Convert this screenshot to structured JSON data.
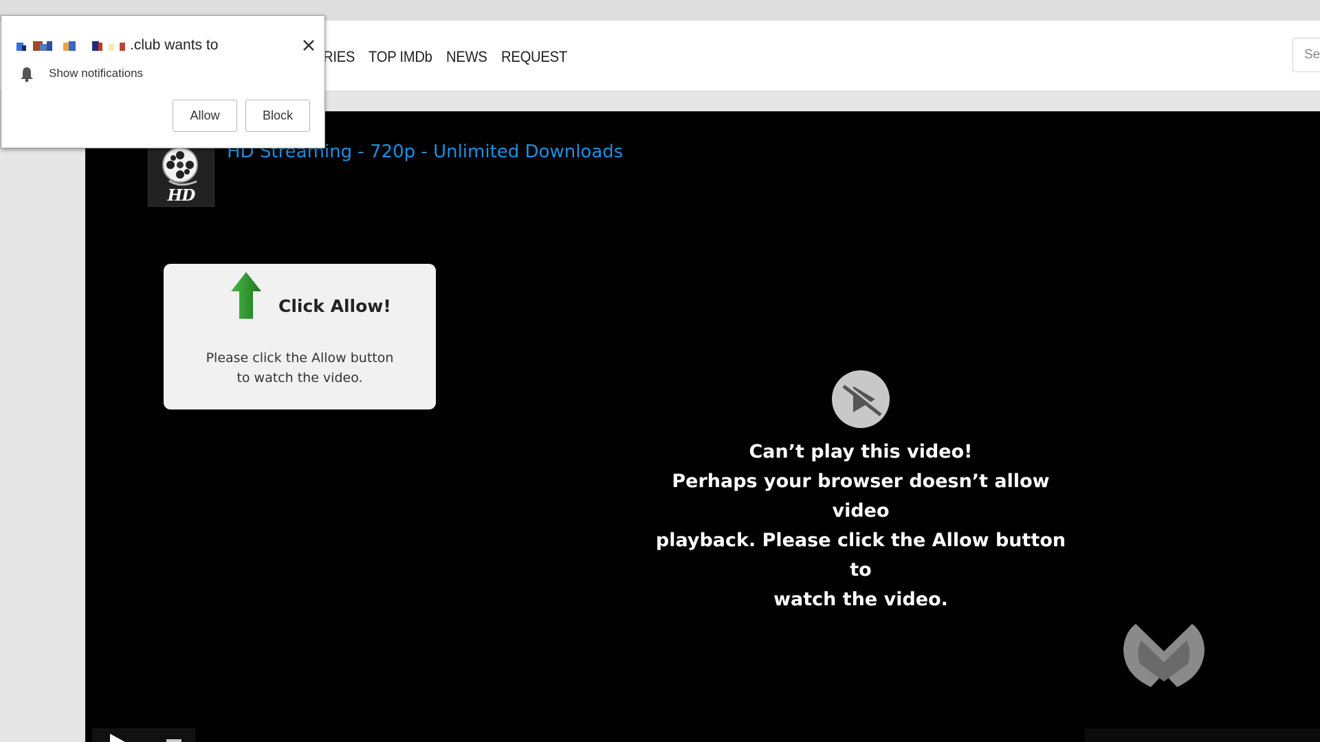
{
  "nav": {
    "items": [
      {
        "label": "RIES"
      },
      {
        "label": "TOP IMDb"
      },
      {
        "label": "NEWS"
      },
      {
        "label": "REQUEST"
      }
    ],
    "search_placeholder": "Se"
  },
  "site": {
    "logo_text": "HD",
    "heading": "HD Streaming - 720p - Unlimited Downloads",
    "heading_color": "#1e90e0"
  },
  "allow_card": {
    "title": "Click Allow!",
    "body_line1": "Please click the Allow button",
    "body_line2": "to watch the video.",
    "arrow_color": "#2a9a2a"
  },
  "player": {
    "message_line1": "Can’t play this video!",
    "message_line2": "Perhaps your browser doesn’t allow video",
    "message_line3": "playback. Please click the Allow button to",
    "message_line4": "watch the video."
  },
  "notification_popup": {
    "origin_suffix": ".club wants to",
    "permission": "Show notifications",
    "allow_label": "Allow",
    "block_label": "Block",
    "icons": [
      "close-icon",
      "bell-icon"
    ]
  }
}
